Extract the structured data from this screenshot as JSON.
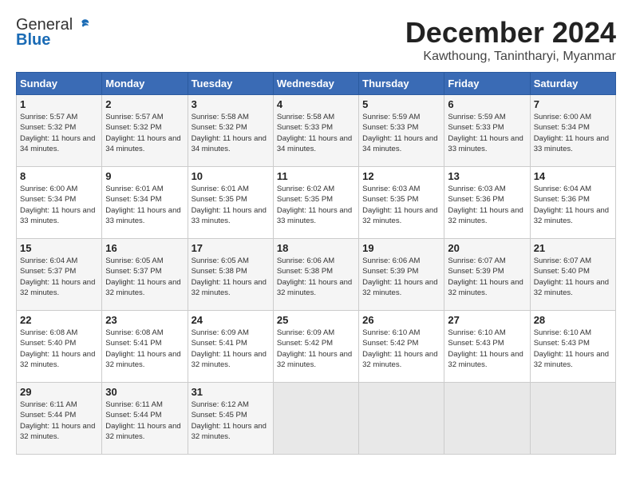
{
  "logo": {
    "general": "General",
    "blue": "Blue"
  },
  "title": "December 2024",
  "location": "Kawthoung, Tanintharyi, Myanmar",
  "days_header": [
    "Sunday",
    "Monday",
    "Tuesday",
    "Wednesday",
    "Thursday",
    "Friday",
    "Saturday"
  ],
  "weeks": [
    [
      {
        "day": "1",
        "rise": "5:57 AM",
        "set": "5:32 PM",
        "daylight": "11 hours and 34 minutes."
      },
      {
        "day": "2",
        "rise": "5:57 AM",
        "set": "5:32 PM",
        "daylight": "11 hours and 34 minutes."
      },
      {
        "day": "3",
        "rise": "5:58 AM",
        "set": "5:32 PM",
        "daylight": "11 hours and 34 minutes."
      },
      {
        "day": "4",
        "rise": "5:58 AM",
        "set": "5:33 PM",
        "daylight": "11 hours and 34 minutes."
      },
      {
        "day": "5",
        "rise": "5:59 AM",
        "set": "5:33 PM",
        "daylight": "11 hours and 34 minutes."
      },
      {
        "day": "6",
        "rise": "5:59 AM",
        "set": "5:33 PM",
        "daylight": "11 hours and 33 minutes."
      },
      {
        "day": "7",
        "rise": "6:00 AM",
        "set": "5:34 PM",
        "daylight": "11 hours and 33 minutes."
      }
    ],
    [
      {
        "day": "8",
        "rise": "6:00 AM",
        "set": "5:34 PM",
        "daylight": "11 hours and 33 minutes."
      },
      {
        "day": "9",
        "rise": "6:01 AM",
        "set": "5:34 PM",
        "daylight": "11 hours and 33 minutes."
      },
      {
        "day": "10",
        "rise": "6:01 AM",
        "set": "5:35 PM",
        "daylight": "11 hours and 33 minutes."
      },
      {
        "day": "11",
        "rise": "6:02 AM",
        "set": "5:35 PM",
        "daylight": "11 hours and 33 minutes."
      },
      {
        "day": "12",
        "rise": "6:03 AM",
        "set": "5:35 PM",
        "daylight": "11 hours and 32 minutes."
      },
      {
        "day": "13",
        "rise": "6:03 AM",
        "set": "5:36 PM",
        "daylight": "11 hours and 32 minutes."
      },
      {
        "day": "14",
        "rise": "6:04 AM",
        "set": "5:36 PM",
        "daylight": "11 hours and 32 minutes."
      }
    ],
    [
      {
        "day": "15",
        "rise": "6:04 AM",
        "set": "5:37 PM",
        "daylight": "11 hours and 32 minutes."
      },
      {
        "day": "16",
        "rise": "6:05 AM",
        "set": "5:37 PM",
        "daylight": "11 hours and 32 minutes."
      },
      {
        "day": "17",
        "rise": "6:05 AM",
        "set": "5:38 PM",
        "daylight": "11 hours and 32 minutes."
      },
      {
        "day": "18",
        "rise": "6:06 AM",
        "set": "5:38 PM",
        "daylight": "11 hours and 32 minutes."
      },
      {
        "day": "19",
        "rise": "6:06 AM",
        "set": "5:39 PM",
        "daylight": "11 hours and 32 minutes."
      },
      {
        "day": "20",
        "rise": "6:07 AM",
        "set": "5:39 PM",
        "daylight": "11 hours and 32 minutes."
      },
      {
        "day": "21",
        "rise": "6:07 AM",
        "set": "5:40 PM",
        "daylight": "11 hours and 32 minutes."
      }
    ],
    [
      {
        "day": "22",
        "rise": "6:08 AM",
        "set": "5:40 PM",
        "daylight": "11 hours and 32 minutes."
      },
      {
        "day": "23",
        "rise": "6:08 AM",
        "set": "5:41 PM",
        "daylight": "11 hours and 32 minutes."
      },
      {
        "day": "24",
        "rise": "6:09 AM",
        "set": "5:41 PM",
        "daylight": "11 hours and 32 minutes."
      },
      {
        "day": "25",
        "rise": "6:09 AM",
        "set": "5:42 PM",
        "daylight": "11 hours and 32 minutes."
      },
      {
        "day": "26",
        "rise": "6:10 AM",
        "set": "5:42 PM",
        "daylight": "11 hours and 32 minutes."
      },
      {
        "day": "27",
        "rise": "6:10 AM",
        "set": "5:43 PM",
        "daylight": "11 hours and 32 minutes."
      },
      {
        "day": "28",
        "rise": "6:10 AM",
        "set": "5:43 PM",
        "daylight": "11 hours and 32 minutes."
      }
    ],
    [
      {
        "day": "29",
        "rise": "6:11 AM",
        "set": "5:44 PM",
        "daylight": "11 hours and 32 minutes."
      },
      {
        "day": "30",
        "rise": "6:11 AM",
        "set": "5:44 PM",
        "daylight": "11 hours and 32 minutes."
      },
      {
        "day": "31",
        "rise": "6:12 AM",
        "set": "5:45 PM",
        "daylight": "11 hours and 32 minutes."
      },
      null,
      null,
      null,
      null
    ]
  ],
  "labels": {
    "sunrise": "Sunrise:",
    "sunset": "Sunset:",
    "daylight": "Daylight:"
  }
}
